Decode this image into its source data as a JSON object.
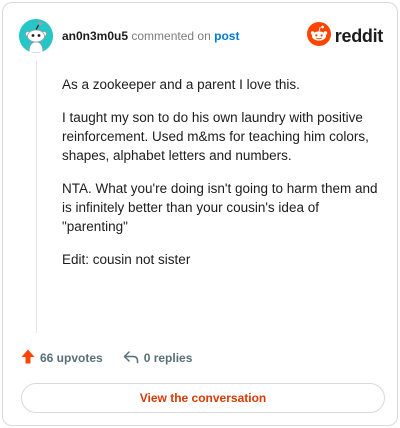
{
  "comment": {
    "username": "an0n3m0u5",
    "action_text": "commented on",
    "post_link": "post",
    "paragraphs": [
      "As a zookeeper and a parent I love this.",
      "I taught my son to do his own laundry with positive reinforcement. Used m&ms for teaching him colors, shapes, alphabet letters and numbers.",
      "NTA. What you're doing isn't going to harm them and is infinitely better than your cousin's idea of \"parenting\"",
      "Edit: cousin not sister"
    ]
  },
  "brand": {
    "name": "reddit",
    "color": "#ff4500"
  },
  "actions": {
    "upvotes": "66 upvotes",
    "replies": "0 replies"
  },
  "cta": {
    "label": "View the conversation"
  },
  "icons": [
    "snoo-avatar-icon",
    "reddit-logo-icon",
    "upvote-arrow-icon",
    "reply-arrow-icon"
  ],
  "colors": {
    "accent": "#d93a00",
    "link": "#0079d3",
    "avatar_bg": "#26c6c6"
  }
}
